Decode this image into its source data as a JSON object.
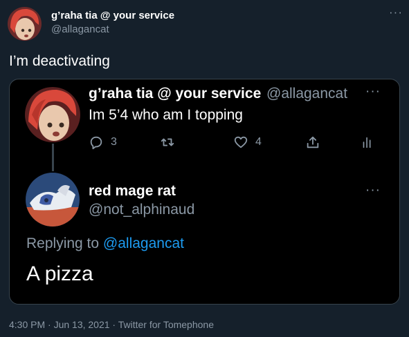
{
  "tweet": {
    "display_name": "g’raha tia @ your service",
    "handle": "@allagancat",
    "text": "I’m deactivating",
    "more": "···"
  },
  "quoted": {
    "display_name": "g’raha tia @ your service",
    "handle": "@allagancat",
    "text": "Im 5’4 who am I topping",
    "more": "···",
    "actions": {
      "reply_icon": "reply-icon",
      "reply_count": "3",
      "retweet_icon": "retweet-icon",
      "like_icon": "heart-icon",
      "like_count": "4",
      "share_icon": "share-icon",
      "analytics_icon": "analytics-icon"
    }
  },
  "reply": {
    "display_name": "red mage rat",
    "handle": "@not_alphinaud",
    "replying_prefix": "Replying to ",
    "replying_to": "@allagancat",
    "text": "A pizza",
    "more": "···"
  },
  "footer": {
    "meta": "4:30 PM · Jun 13, 2021 · Twitter for Tomephone"
  },
  "colors": {
    "background": "#15202b",
    "card": "#000000",
    "muted": "#8b98a5",
    "link": "#1d9bf0"
  }
}
